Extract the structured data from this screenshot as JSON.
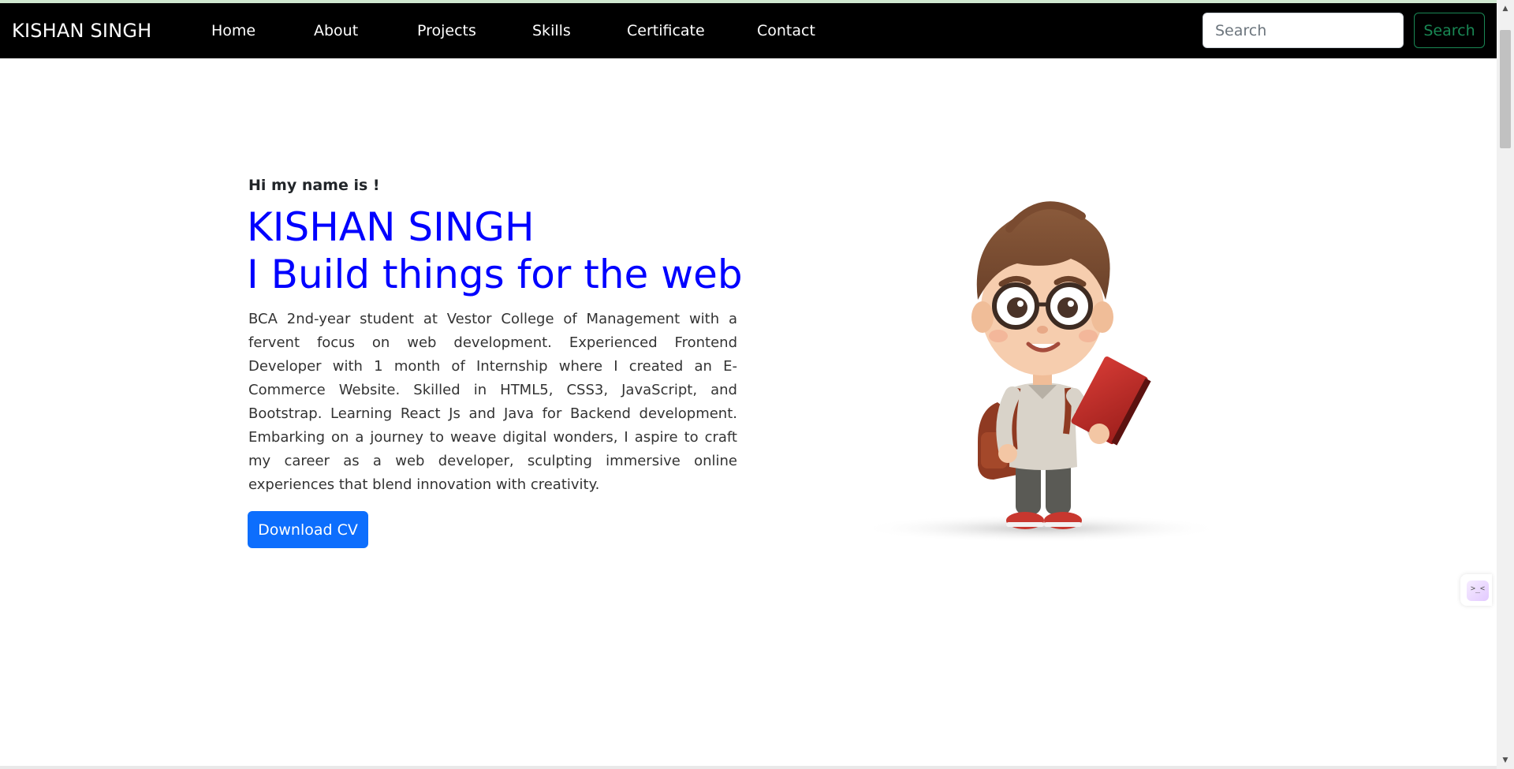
{
  "navbar": {
    "brand": "KISHAN SINGH",
    "items": [
      {
        "label": "Home"
      },
      {
        "label": "About"
      },
      {
        "label": "Projects"
      },
      {
        "label": "Skills"
      },
      {
        "label": "Certificate"
      },
      {
        "label": "Contact"
      }
    ],
    "search": {
      "placeholder": "Search",
      "button_label": "Search"
    }
  },
  "hero": {
    "intro": "Hi my name is !",
    "name": "KISHAN SINGH",
    "tagline": "I Build things for the web",
    "bio": "BCA 2nd-year student at Vestor College of Management with a fervent focus on web development. Experienced Frontend Developer with 1 month of Internship where I created an E-Commerce Website. Skilled in HTML5, CSS3, JavaScript, and Bootstrap. Learning React Js and Java for Backend development. Embarking on a journey to weave digital wonders, I aspire to craft my career as a web developer, sculpting immersive online experiences that blend innovation with creativity.",
    "cta_label": "Download CV",
    "illustration": "cartoon-boy-with-book"
  },
  "widget": {
    "icon": "code-widget-icon",
    "glyph": ">_<"
  },
  "colors": {
    "nav_bg": "#000000",
    "accent_blue": "#0000ff",
    "primary_button": "#0d6efd",
    "search_button": "#198754"
  }
}
